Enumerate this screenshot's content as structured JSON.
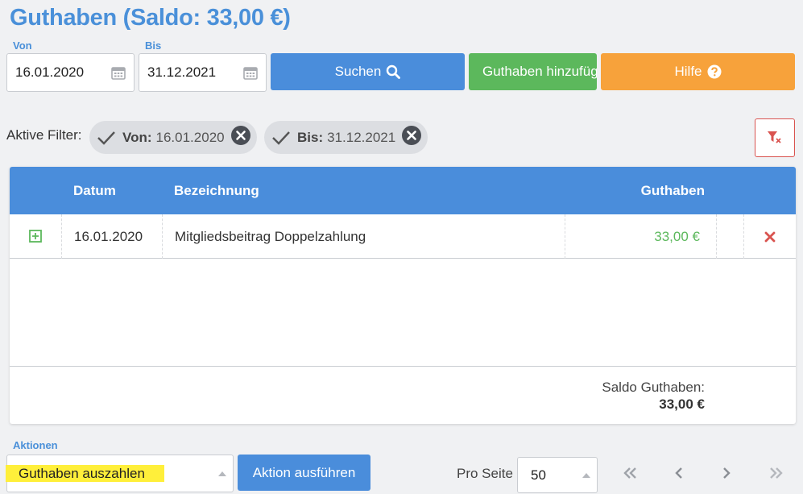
{
  "header": {
    "title": "Guthaben (Saldo: 33,00 €)"
  },
  "search": {
    "from_label": "Von",
    "from_value": "16.01.2020",
    "to_label": "Bis",
    "to_value": "31.12.2021",
    "search_button": "Suchen",
    "add_button": "Guthaben hinzufügen",
    "help_button": "Hilfe"
  },
  "filters": {
    "label": "Aktive Filter:",
    "chips": [
      {
        "key": "Von:",
        "value": "16.01.2020"
      },
      {
        "key": "Bis:",
        "value": "31.12.2021"
      }
    ]
  },
  "table": {
    "columns": [
      "Datum",
      "Bezeichnung",
      "Guthaben"
    ],
    "rows": [
      {
        "datum": "16.01.2020",
        "bezeichnung": "Mitgliedsbeitrag Doppelzahlung",
        "guthaben": "33,00 €"
      }
    ],
    "footer_label": "Saldo Guthaben:",
    "footer_sum": "33,00 €"
  },
  "actions": {
    "label": "Aktionen",
    "selected": "Guthaben auszahlen",
    "execute_button": "Aktion ausführen"
  },
  "pagination": {
    "per_page_label": "Pro Seite",
    "per_page_value": "50"
  },
  "colors": {
    "primary": "#4a8ddb",
    "success": "#5cb85c",
    "warning": "#f7a23b",
    "danger": "#d9534f",
    "highlight": "#ffef3a"
  },
  "icons": {
    "calendar": "calendar-icon",
    "search": "search-icon",
    "help": "question-circle-icon",
    "check": "check-icon",
    "remove": "close-circle-icon",
    "filter_reset": "filter-clear-icon",
    "expand": "plus-square-icon",
    "delete": "x-icon"
  }
}
